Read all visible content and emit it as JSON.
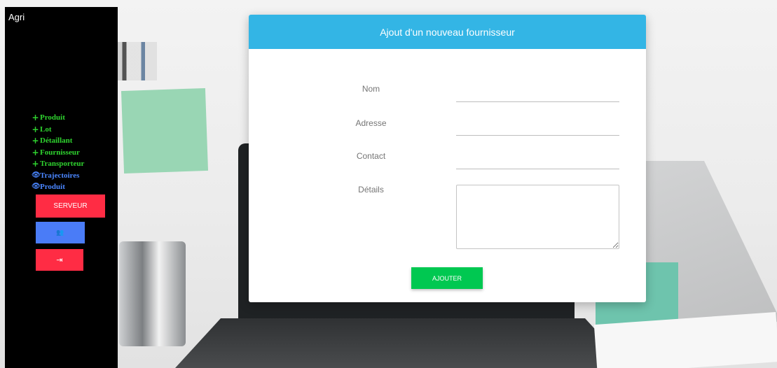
{
  "sidebar": {
    "brand": "Agri",
    "menu": [
      {
        "icon": "plus-icon",
        "glyph": "+",
        "label": "Produit",
        "kind": "add"
      },
      {
        "icon": "plus-icon",
        "glyph": "+",
        "label": "Lot",
        "kind": "add"
      },
      {
        "icon": "plus-icon",
        "glyph": "+",
        "label": "Détaillant",
        "kind": "add"
      },
      {
        "icon": "plus-icon",
        "glyph": "+",
        "label": "Fournisseur",
        "kind": "add"
      },
      {
        "icon": "plus-icon",
        "glyph": "+",
        "label": "Transporteur",
        "kind": "add"
      },
      {
        "icon": "eye-icon",
        "glyph": "👁",
        "label": "Trajectoires",
        "kind": "view"
      },
      {
        "icon": "eye-icon",
        "glyph": "👁",
        "label": "Produit",
        "kind": "view"
      }
    ],
    "server_button": "SERVEUR",
    "users_button_icon": "users-icon",
    "users_glyph": "👥",
    "logout_button_icon": "sign-out-icon",
    "logout_glyph": "⇥"
  },
  "form": {
    "title": "Ajout d'un nouveau fournisseur",
    "fields": {
      "nom": {
        "label": "Nom",
        "value": ""
      },
      "adresse": {
        "label": "Adresse",
        "value": ""
      },
      "contact": {
        "label": "Contact",
        "value": ""
      },
      "details": {
        "label": "Détails",
        "value": ""
      }
    },
    "submit": "AJOUTER"
  },
  "colors": {
    "header": "#33b5e5",
    "add_green": "#2fd32f",
    "view_blue": "#4a86ff",
    "danger": "#ff2c44",
    "primary": "#4a7cf7",
    "success": "#00c851"
  }
}
